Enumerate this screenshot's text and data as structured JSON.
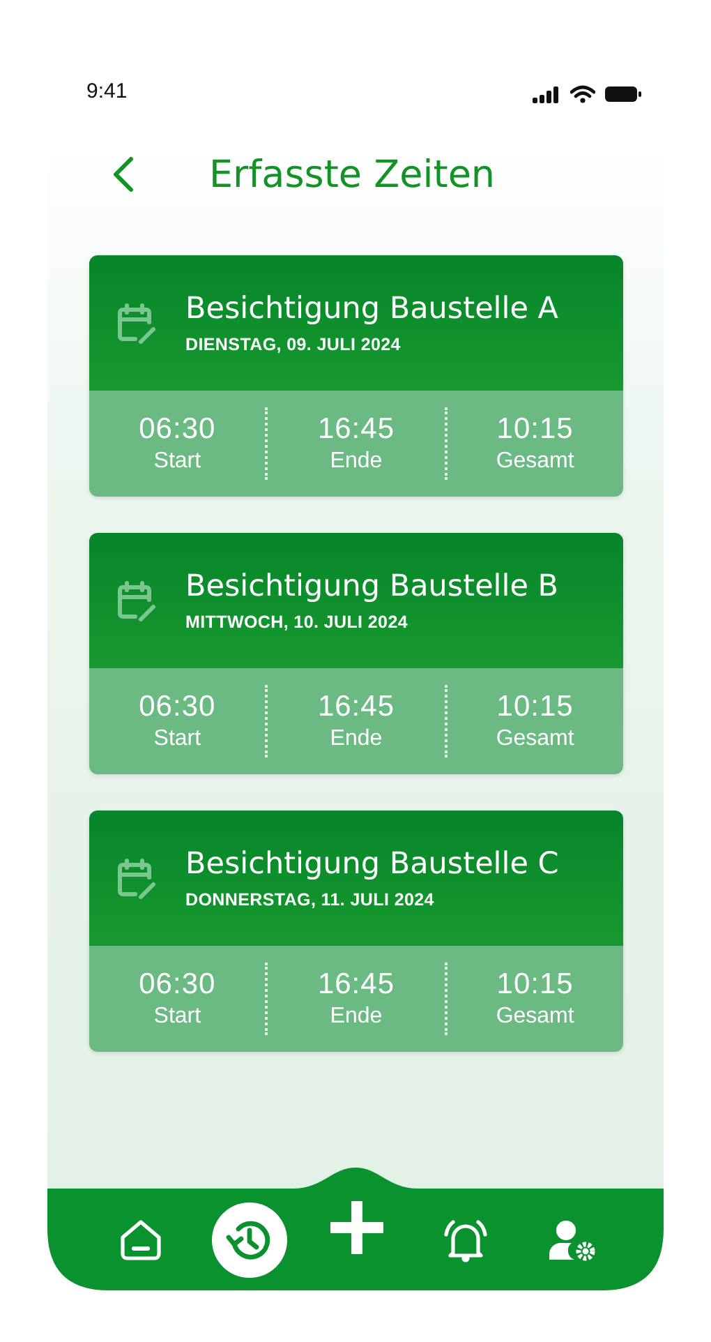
{
  "status_bar": {
    "time": "9:41"
  },
  "header": {
    "title": "Erfasste Zeiten"
  },
  "entries": [
    {
      "title": "Besichtigung Baustelle A",
      "date": "DIENSTAG, 09. JULI 2024",
      "stats": [
        {
          "value": "06:30",
          "label": "Start"
        },
        {
          "value": "16:45",
          "label": "Ende"
        },
        {
          "value": "10:15",
          "label": "Gesamt"
        }
      ]
    },
    {
      "title": "Besichtigung Baustelle B",
      "date": "MITTWOCH, 10. JULI 2024",
      "stats": [
        {
          "value": "06:30",
          "label": "Start"
        },
        {
          "value": "16:45",
          "label": "Ende"
        },
        {
          "value": "10:15",
          "label": "Gesamt"
        }
      ]
    },
    {
      "title": "Besichtigung Baustelle C",
      "date": "DONNERSTAG, 11. JULI 2024",
      "stats": [
        {
          "value": "06:30",
          "label": "Start"
        },
        {
          "value": "16:45",
          "label": "Ende"
        },
        {
          "value": "10:15",
          "label": "Gesamt"
        }
      ]
    }
  ],
  "nav": [
    {
      "kind": "home",
      "selected": false
    },
    {
      "kind": "history",
      "selected": true
    },
    {
      "kind": "add",
      "selected": false
    },
    {
      "kind": "alarm",
      "selected": false
    },
    {
      "kind": "user-settings",
      "selected": false
    }
  ]
}
